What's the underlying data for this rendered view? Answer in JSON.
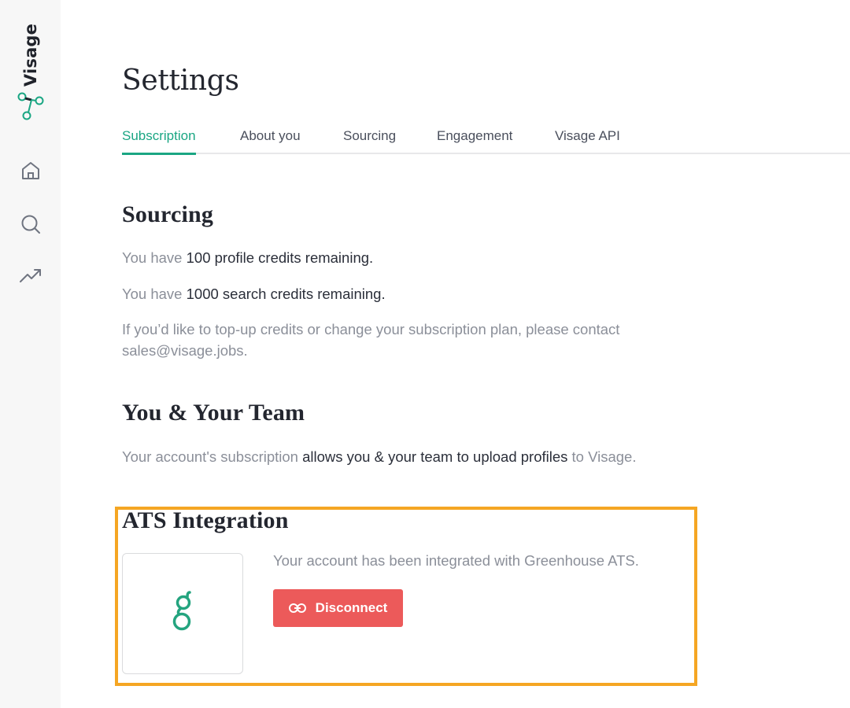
{
  "brand": {
    "name": "Visage",
    "accent": "#1aa683"
  },
  "sidebar": {
    "items": [
      {
        "icon": "home-icon"
      },
      {
        "icon": "search-icon"
      },
      {
        "icon": "trending-up-icon"
      }
    ]
  },
  "page": {
    "title": "Settings"
  },
  "tabs": [
    {
      "label": "Subscription",
      "active": true
    },
    {
      "label": "About you"
    },
    {
      "label": "Sourcing"
    },
    {
      "label": "Engagement"
    },
    {
      "label": "Visage API"
    }
  ],
  "sourcing": {
    "title": "Sourcing",
    "profile_prefix": "You have ",
    "profile_strong": "100 profile credits remaining.",
    "search_prefix": "You have ",
    "search_strong": "1000 search credits remaining.",
    "contact_line1": "If you’d like to top-up credits or change your subscription plan, please contact",
    "contact_line2": "sales@visage.jobs."
  },
  "team": {
    "title": "You & Your Team",
    "part1": "Your account's subscription ",
    "part2": "allows you & your team to upload profiles",
    "part3": " to Visage."
  },
  "ats": {
    "title": "ATS Integration",
    "status": "Your account has been integrated with Greenhouse ATS.",
    "disconnect_label": "Disconnect",
    "logo_icon": "greenhouse-logo-icon",
    "highlight_color": "#f5a623",
    "button_color": "#ec5a5a"
  }
}
